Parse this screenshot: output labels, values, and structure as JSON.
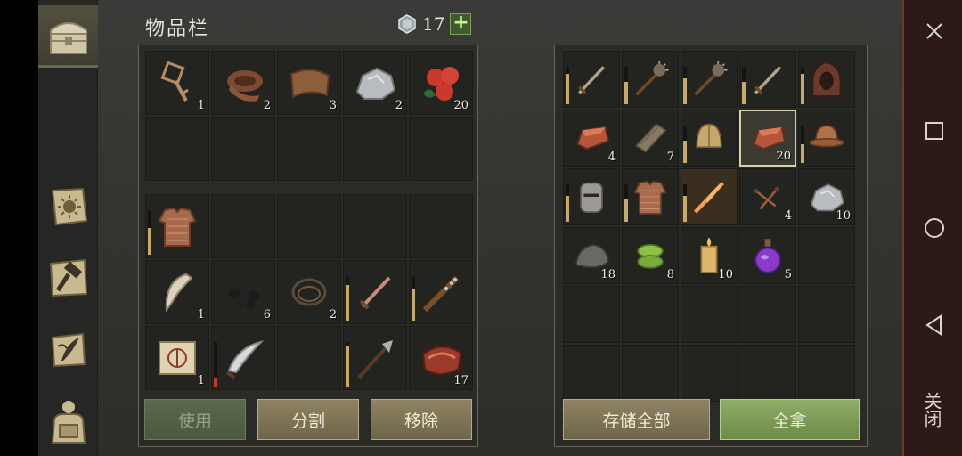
{
  "title": "物品栏",
  "capacity": "17",
  "tabs": [
    {
      "icon": "chest-icon",
      "active": true
    },
    {
      "icon": "sun-book-icon",
      "active": false
    },
    {
      "icon": "craft-hammer-icon",
      "active": false
    },
    {
      "icon": "scroll-quill-icon",
      "active": false
    },
    {
      "icon": "backpack-icon",
      "active": false
    }
  ],
  "inventory": {
    "quick_slots": [
      {
        "icon": "ornate-key-icon",
        "count": "1"
      },
      {
        "icon": "leather-roll-icon",
        "count": "2"
      },
      {
        "icon": "hide-scrap-icon",
        "count": "3"
      },
      {
        "icon": "stone-ore-icon",
        "count": "2"
      },
      {
        "icon": "berries-icon",
        "count": "20"
      },
      null,
      null,
      null,
      null,
      null
    ],
    "backpack_slots": [
      {
        "icon": "chainmail-shirt-icon",
        "count": "",
        "durability": 0.6
      },
      null,
      null,
      null,
      null,
      {
        "icon": "fang-icon",
        "count": "1"
      },
      {
        "icon": "coal-icon",
        "count": "6"
      },
      {
        "icon": "rope-icon",
        "count": "2"
      },
      {
        "icon": "dagger-icon",
        "count": "",
        "durability": 0.8
      },
      {
        "icon": "spiked-club-icon",
        "count": "",
        "durability": 0.7
      },
      {
        "icon": "treasure-map-icon",
        "count": "1"
      },
      {
        "icon": "scimitar-icon",
        "count": "",
        "durability": 0.2,
        "durability_color": "red"
      },
      null,
      {
        "icon": "halberd-icon",
        "count": "",
        "durability": 0.9
      },
      {
        "icon": "raw-meat-icon",
        "count": "17"
      }
    ],
    "buttons": {
      "use": "使用",
      "split": "分割",
      "remove": "移除"
    }
  },
  "storage": {
    "slots": [
      {
        "icon": "sword-icon",
        "count": "",
        "durability": 0.8
      },
      {
        "icon": "morning-star-icon",
        "count": "",
        "durability": 0.6
      },
      {
        "icon": "morning-star-icon",
        "count": "",
        "durability": 0.7
      },
      {
        "icon": "sword-icon",
        "count": "",
        "durability": 0.6
      },
      {
        "icon": "hood-icon",
        "count": "",
        "durability": 0.8
      },
      {
        "icon": "copper-ingot-icon",
        "count": "4"
      },
      {
        "icon": "wood-plank-icon",
        "count": "7"
      },
      {
        "icon": "leather-cap-icon",
        "count": "",
        "durability": 0.6
      },
      {
        "icon": "copper-ingot-icon",
        "count": "20",
        "selected": true
      },
      {
        "icon": "kettle-helmet-icon",
        "count": "",
        "durability": 0.5
      },
      {
        "icon": "great-helm-icon",
        "count": "",
        "durability": 0.7
      },
      {
        "icon": "chainmail-shirt-icon",
        "count": "",
        "durability": 0.6
      },
      {
        "icon": "flaming-sword-icon",
        "count": "",
        "durability": 0.7,
        "highlight": true
      },
      {
        "icon": "nails-icon",
        "count": "4"
      },
      {
        "icon": "stone-ore-icon",
        "count": "10"
      },
      {
        "icon": "rock-icon",
        "count": "18"
      },
      {
        "icon": "rope-coil-icon",
        "count": "8"
      },
      {
        "icon": "candle-icon",
        "count": "10"
      },
      {
        "icon": "potion-icon",
        "count": "5"
      },
      null,
      null,
      null,
      null,
      null,
      null,
      null,
      null,
      null,
      null,
      null
    ],
    "buttons": {
      "store_all": "存储全部",
      "take_all": "全拿"
    }
  },
  "navbar": {
    "close_text": "关闭",
    "icons": [
      "close-icon",
      "square-nav-icon",
      "circle-nav-icon",
      "back-triangle-icon"
    ]
  }
}
